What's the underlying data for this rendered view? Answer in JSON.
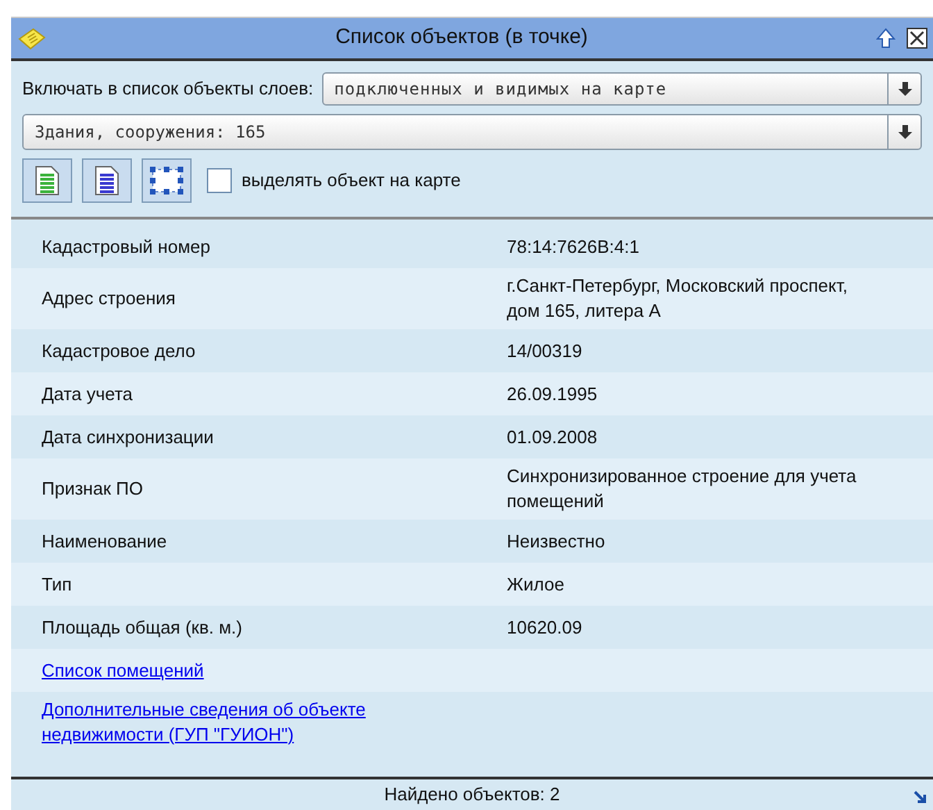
{
  "window": {
    "title": "Список объектов (в точке)"
  },
  "layer_filter": {
    "label": "Включать в список объекты слоев:",
    "value": "подключенных и видимых на карте"
  },
  "object_select": {
    "value": "Здания, сооружения: 165"
  },
  "highlight_checkbox": {
    "label": "выделять объект на карте",
    "checked": false
  },
  "properties": [
    {
      "label": "Кадастровый номер",
      "value": "78:14:7626В:4:1"
    },
    {
      "label": "Адрес строения",
      "value": "г.Санкт-Петербург, Московский проспект, дом 165, литера А"
    },
    {
      "label": "Кадастровое дело",
      "value": "14/00319"
    },
    {
      "label": "Дата учета",
      "value": "26.09.1995"
    },
    {
      "label": "Дата синхронизации",
      "value": "01.09.2008"
    },
    {
      "label": "Признак ПО",
      "value": "Синхронизированное строение для учета помещений"
    },
    {
      "label": "Наименование",
      "value": "Неизвестно"
    },
    {
      "label": "Тип",
      "value": "Жилое"
    },
    {
      "label": "Площадь общая (кв. м.)",
      "value": "10620.09"
    }
  ],
  "links": [
    "Список помещений",
    "Дополнительные сведения об объекте недвижимости (ГУП \"ГУИОН\")"
  ],
  "status_bar": "Найдено объектов: 2"
}
